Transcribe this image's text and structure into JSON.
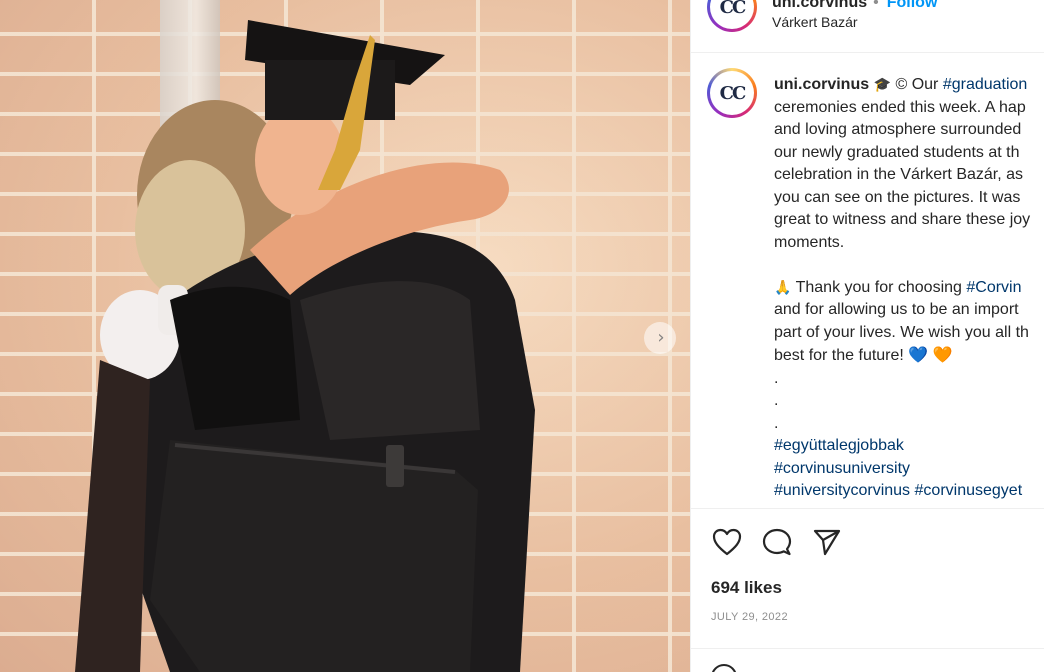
{
  "post": {
    "username": "uni.corvinus",
    "follow_label": "Follow",
    "location": "Várkert Bazár",
    "avatar_text": "CC"
  },
  "caption": {
    "username": "uni.corvinus",
    "cap_emoji": "🎓",
    "line1_text": " © Our ",
    "line1_tag": "#graduation",
    "line2": "ceremonies ended this week. A hap",
    "line3": "and loving atmosphere surrounded",
    "line4": "our newly graduated students at th",
    "line5": "celebration in the Várkert Bazár, as",
    "line6": "you can see on the pictures. It was",
    "line7": "great to witness and share these joy",
    "line8": "moments.",
    "pray_emoji": "🙏",
    "line9_text": " Thank you for choosing ",
    "line9_tag": "#Corvin",
    "line10": "and for allowing us to be an import",
    "line11": "part of your lives. We wish you all th",
    "line12_text": "best for the future! ",
    "heart_blue": "💙",
    "heart_orange": "🧡",
    "dot1": ".",
    "dot2": ".",
    "dot3": ".",
    "tag1": "#együttalegjobbak",
    "tag2": "#corvinusuniversity",
    "tag3a": "#universitycorvinus",
    "tag3b": "#corvinusegyet"
  },
  "stats": {
    "likes": "694 likes",
    "date": "JULY 29, 2022"
  },
  "icons": {
    "like": "heart-icon",
    "comment": "comment-icon",
    "share": "share-icon",
    "next": "chevron-right-icon"
  },
  "colors": {
    "link": "#00376b",
    "follow": "#0095f6",
    "muted": "#8e8e8e"
  }
}
